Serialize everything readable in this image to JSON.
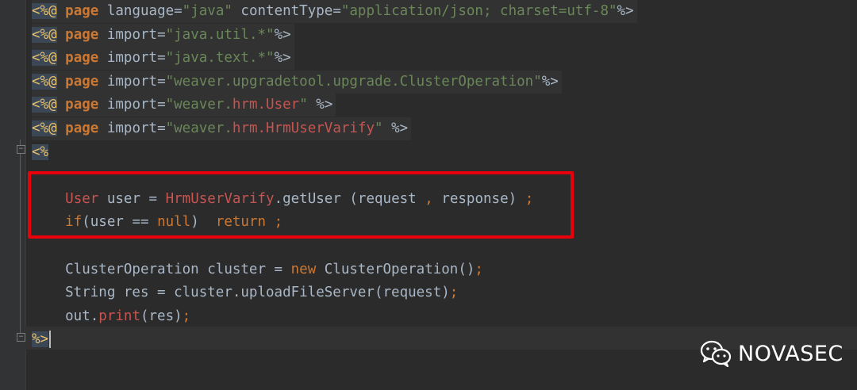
{
  "editor": {
    "language": "JSP",
    "lines": [
      {
        "parts": [
          [
            "<%@",
            "tag"
          ],
          [
            " ",
            ""
          ],
          [
            "page",
            "kw"
          ],
          [
            " language=",
            ""
          ],
          [
            "\"java\"",
            "str"
          ],
          [
            " contentType=",
            ""
          ],
          [
            "\"application/json; charset=utf-8\"",
            "str"
          ],
          [
            "%>",
            ""
          ]
        ]
      },
      {
        "parts": [
          [
            "<%@",
            "tag"
          ],
          [
            " ",
            ""
          ],
          [
            "page",
            "kw"
          ],
          [
            " import=",
            ""
          ],
          [
            "\"java.util.*\"",
            "str"
          ],
          [
            "%>",
            ""
          ]
        ]
      },
      {
        "parts": [
          [
            "<%@",
            "tag"
          ],
          [
            " ",
            ""
          ],
          [
            "page",
            "kw"
          ],
          [
            " import=",
            ""
          ],
          [
            "\"java.text.*\"",
            "str"
          ],
          [
            "%>",
            ""
          ]
        ]
      },
      {
        "parts": [
          [
            "<%@",
            "tag"
          ],
          [
            " ",
            ""
          ],
          [
            "page",
            "kw"
          ],
          [
            " import=",
            ""
          ],
          [
            "\"weaver.upgradetool.upgrade.ClusterOperation\"",
            "str"
          ],
          [
            "%>",
            ""
          ]
        ]
      },
      {
        "parts": [
          [
            "<%@",
            "tag"
          ],
          [
            " ",
            ""
          ],
          [
            "page",
            "kw"
          ],
          [
            " import=",
            ""
          ],
          [
            "\"weaver.",
            "str"
          ],
          [
            "hrm.User",
            "cls"
          ],
          [
            "\"",
            "str"
          ],
          [
            " %>",
            ""
          ]
        ]
      },
      {
        "parts": [
          [
            "<%@",
            "tag"
          ],
          [
            " ",
            ""
          ],
          [
            "page",
            "kw"
          ],
          [
            " import=",
            ""
          ],
          [
            "\"weaver.",
            "str"
          ],
          [
            "hrm.HrmUserVarify",
            "cls"
          ],
          [
            "\"",
            "str"
          ],
          [
            " %>",
            ""
          ]
        ]
      },
      {
        "parts": [
          [
            "<%",
            "tag"
          ]
        ]
      },
      {
        "parts": []
      },
      {
        "parts": [
          [
            "    ",
            ""
          ],
          [
            "User",
            "cls"
          ],
          [
            " user = ",
            ""
          ],
          [
            "HrmUserVarify",
            "cls"
          ],
          [
            ".getUser (request ",
            ""
          ],
          [
            ",",
            "punc"
          ],
          [
            " response) ",
            ""
          ],
          [
            ";",
            "punc"
          ]
        ]
      },
      {
        "parts": [
          [
            "    ",
            ""
          ],
          [
            "if",
            "kw2"
          ],
          [
            "(user == ",
            ""
          ],
          [
            "null",
            "kw2"
          ],
          [
            ")  ",
            ""
          ],
          [
            "return",
            "kw2"
          ],
          [
            " ",
            ""
          ],
          [
            ";",
            "punc"
          ]
        ]
      },
      {
        "parts": []
      },
      {
        "parts": [
          [
            "    ClusterOperation cluster = ",
            ""
          ],
          [
            "new",
            "kw2"
          ],
          [
            " ClusterOperation()",
            ""
          ],
          [
            ";",
            "punc"
          ]
        ]
      },
      {
        "parts": [
          [
            "    String res = cluster.uploadFileServer(request)",
            ""
          ],
          [
            ";",
            "punc"
          ]
        ]
      },
      {
        "parts": [
          [
            "    out.",
            ""
          ],
          [
            "print",
            "cls"
          ],
          [
            "(res)",
            ""
          ],
          [
            ";",
            "punc"
          ]
        ]
      },
      {
        "parts": [
          [
            "%>",
            "tag"
          ]
        ]
      }
    ]
  },
  "brand": {
    "name": "NOVASEC",
    "icon": "wechat-icon"
  },
  "colors": {
    "background": "#2b2b2b",
    "keyword": "#cc7832",
    "string": "#6a8759",
    "class_ref": "#c75450",
    "highlight_box": "#e8000b"
  }
}
